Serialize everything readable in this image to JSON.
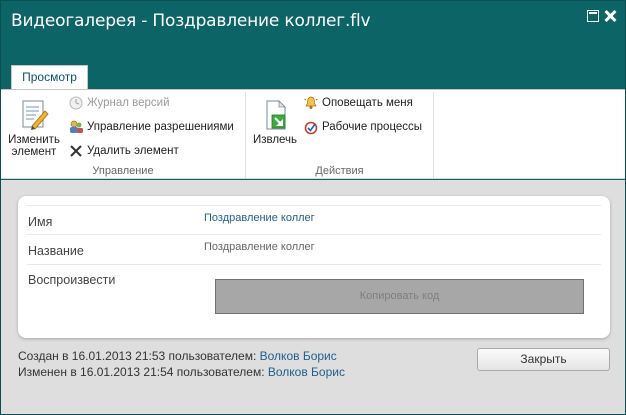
{
  "window": {
    "title": "Видеогалерея - Поздравление коллег.flv"
  },
  "ribbon": {
    "tab_label": "Просмотр",
    "manage_group": {
      "label": "Управление",
      "edit_item": "Изменить элемент",
      "edit_item_line1": "Изменить",
      "edit_item_line2": "элемент",
      "version_history": "Журнал версий",
      "manage_permissions": "Управление разрешениями",
      "delete_item": "Удалить элемент"
    },
    "actions_group": {
      "label": "Действия",
      "check_out": "Извлечь",
      "alert_me": "Оповещать меня",
      "workflows": "Рабочие процессы"
    }
  },
  "properties": {
    "name_label": "Имя",
    "name_value": "Поздравление коллег",
    "title_label": "Название",
    "title_value": "Поздравление коллег",
    "play_label": "Воспроизвести",
    "copy_code_label": "Копировать код"
  },
  "footer": {
    "created_text": "Создан в 16.01.2013 21:53 пользователем:",
    "created_user": "Волков Борис",
    "modified_text": "Изменен в 16.01.2013 21:54 пользователем:",
    "modified_user": "Волков Борис",
    "close_label": "Закрыть"
  }
}
